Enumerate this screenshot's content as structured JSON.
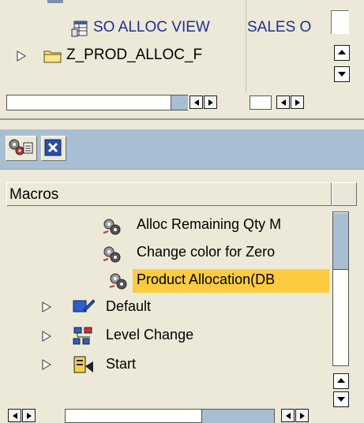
{
  "top_tree": {
    "so_alloc_view": "SO ALLOC VIEW",
    "sales_col": "SALES O",
    "z_prod_alloc": "Z_PROD_ALLOC_F"
  },
  "macros_panel": {
    "header": "Macros",
    "items": [
      {
        "label": "Alloc Remaining Qty M",
        "icon": "macro-gear-icon",
        "selected": false
      },
      {
        "label": "Change color for Zero",
        "icon": "macro-gear-icon",
        "selected": false
      },
      {
        "label": "Product Allocation(DB",
        "icon": "macro-gear-icon",
        "selected": true
      }
    ],
    "folders": [
      {
        "label": "Default",
        "icon": "default-folder-icon"
      },
      {
        "label": "Level Change",
        "icon": "level-change-icon"
      },
      {
        "label": "Start",
        "icon": "start-icon"
      }
    ]
  },
  "colors": {
    "selection": "#fdcb3f",
    "toolbar_band": "#a8bfd3",
    "window_bg": "#ece9d8"
  }
}
